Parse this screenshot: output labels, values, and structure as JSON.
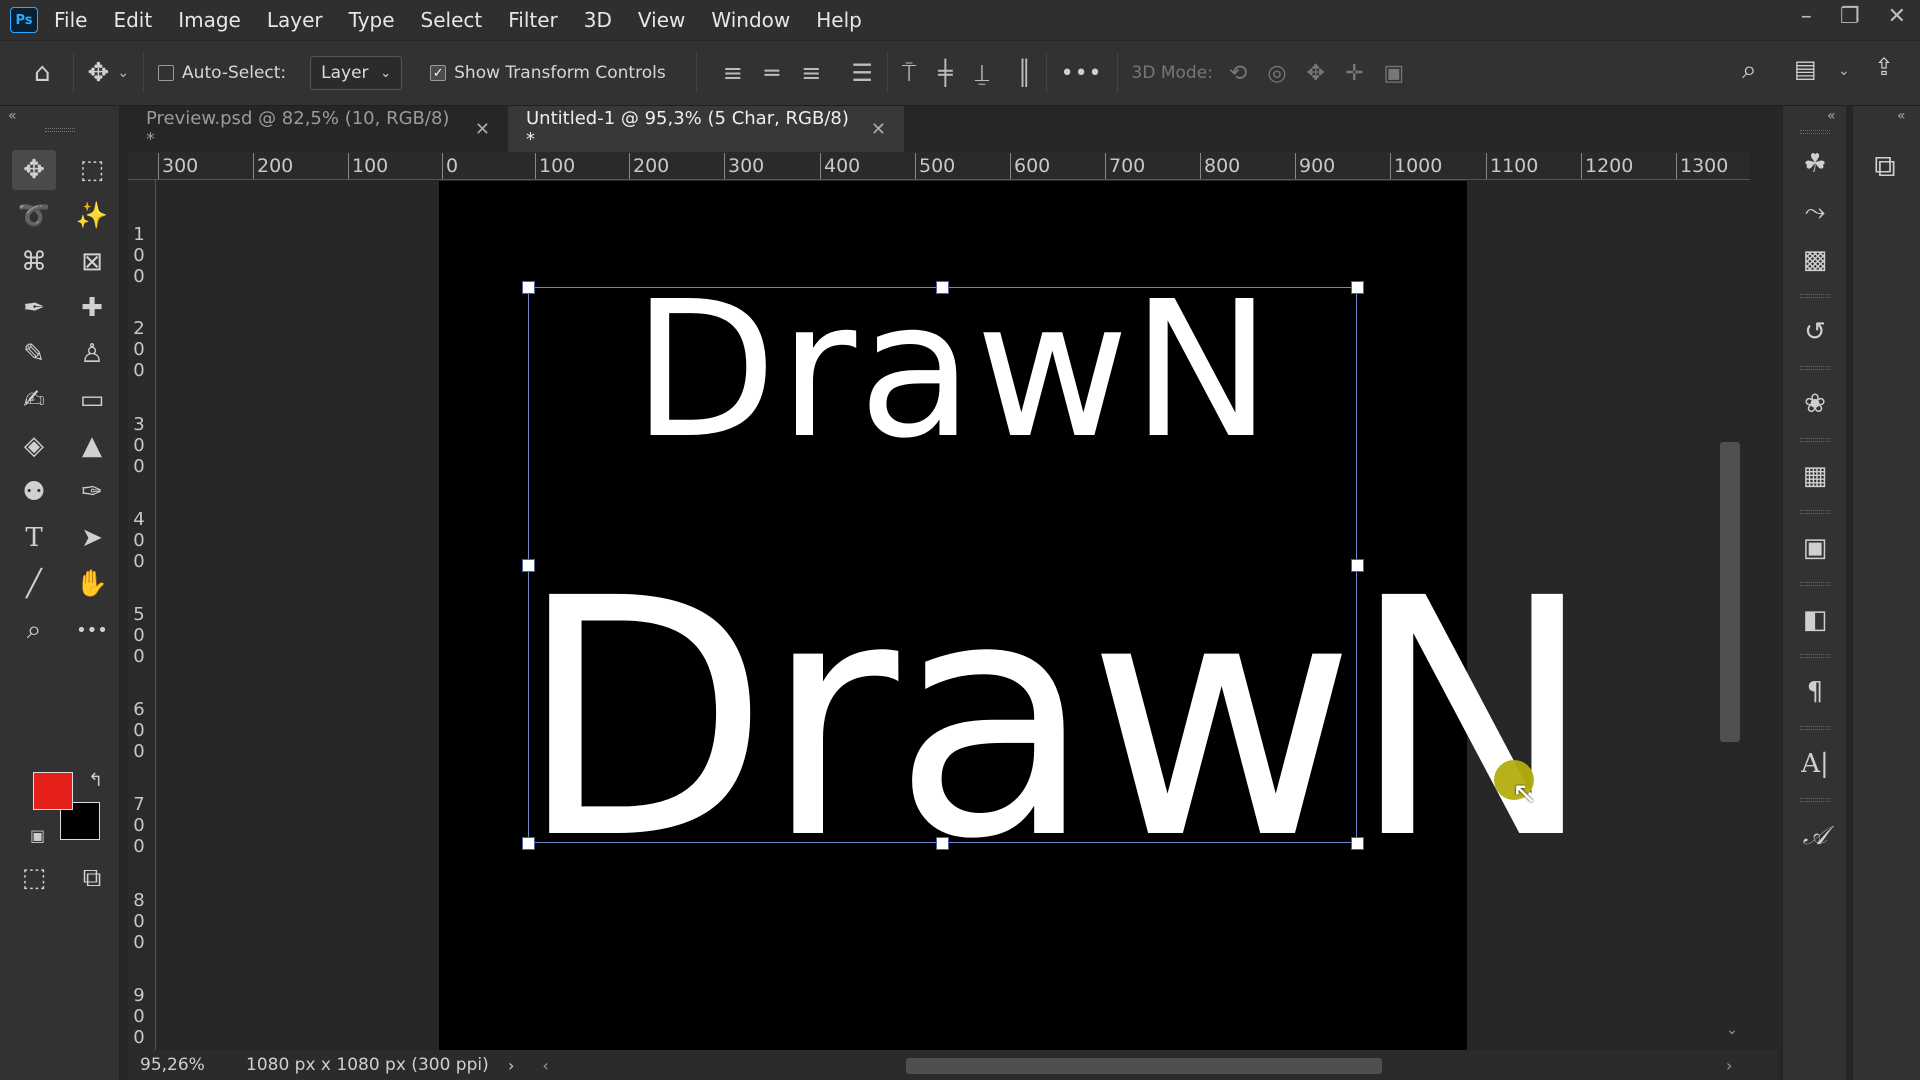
{
  "menubar": {
    "logo": "Ps",
    "items": [
      "File",
      "Edit",
      "Image",
      "Layer",
      "Type",
      "Select",
      "Filter",
      "3D",
      "View",
      "Window",
      "Help"
    ]
  },
  "options": {
    "auto_select_label": "Auto-Select:",
    "auto_select_checked": false,
    "layer_dropdown": "Layer",
    "show_transform_label": "Show Transform Controls",
    "show_transform_checked": true,
    "mode3d_label": "3D Mode:"
  },
  "tabs": [
    {
      "label": "Preview.psd @ 82,5% (10, RGB/8) *",
      "active": false
    },
    {
      "label": "Untitled-1 @ 95,3% (5 Char, RGB/8) *",
      "active": true
    }
  ],
  "ruler": {
    "h_labels": [
      "300",
      "200",
      "100",
      "0",
      "100",
      "200",
      "300",
      "400",
      "500",
      "600",
      "700",
      "800",
      "900",
      "1000",
      "1100",
      "1200",
      "1300"
    ],
    "v_labels": [
      "100",
      "200",
      "300",
      "400",
      "500",
      "600",
      "700",
      "800",
      "900"
    ]
  },
  "canvas": {
    "text_top": "DrawN",
    "text_bottom": "DrawN"
  },
  "status": {
    "zoom": "95,26%",
    "doc_info": "1080 px x 1080 px (300 ppi)"
  },
  "colors": {
    "foreground": "#e5201b",
    "background": "#000000"
  }
}
